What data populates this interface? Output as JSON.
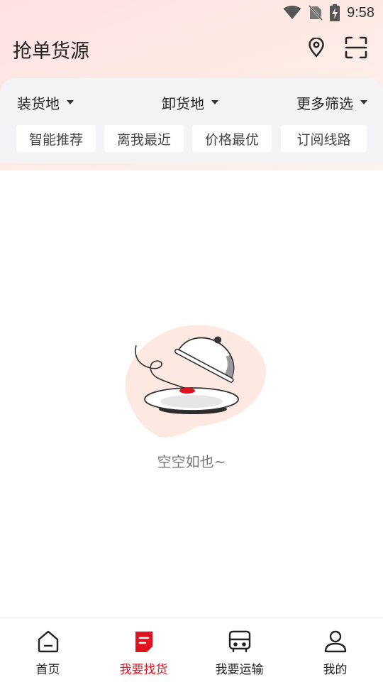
{
  "status_bar": {
    "time": "9:58"
  },
  "header": {
    "title": "抢单货源",
    "location_icon": "location-pin-icon",
    "scan_icon": "scan-icon"
  },
  "filters": {
    "dropdowns": [
      "装货地",
      "卸货地",
      "更多筛选"
    ],
    "chips": [
      "智能推荐",
      "离我最近",
      "价格最优",
      "订阅线路"
    ]
  },
  "empty_state": {
    "text": "空空如也~"
  },
  "bottom_nav": {
    "items": [
      {
        "label": "首页",
        "icon": "home-icon",
        "active": false
      },
      {
        "label": "我要找货",
        "icon": "cargo-doc-icon",
        "active": true
      },
      {
        "label": "我要运输",
        "icon": "truck-icon",
        "active": false
      },
      {
        "label": "我的",
        "icon": "user-icon",
        "active": false
      }
    ]
  },
  "colors": {
    "accent": "#e0121f",
    "panel_bg": "#f4f4f6",
    "header_gradient_start": "#fde2e2"
  }
}
